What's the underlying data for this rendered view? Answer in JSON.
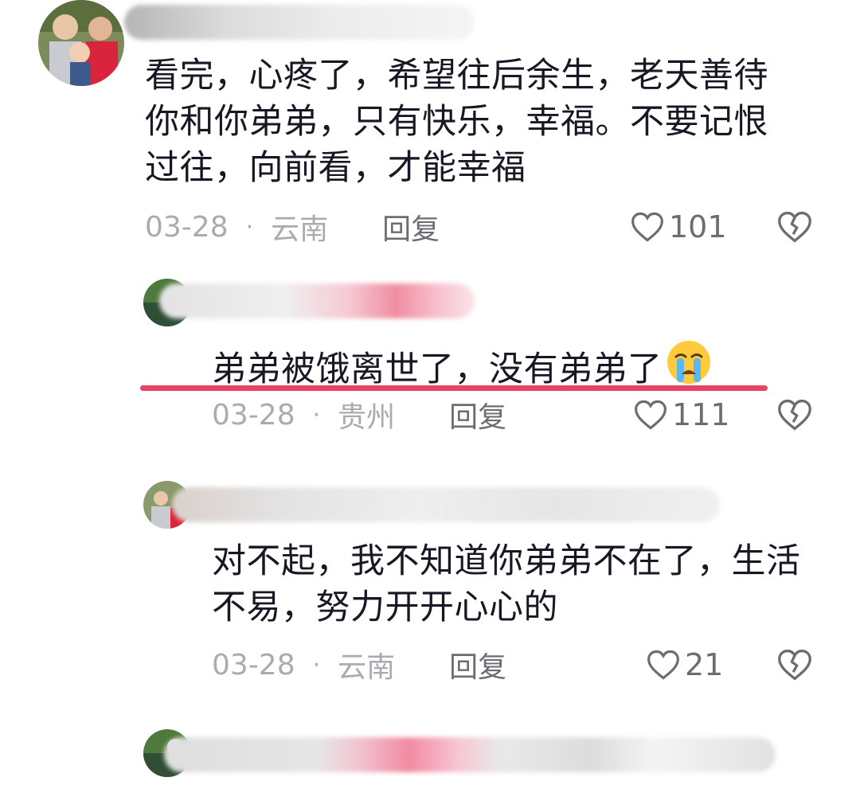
{
  "comments": [
    {
      "text_lines": [
        "看完，心疼了，希望往后余生，老天善待",
        "你和你弟弟，只有快乐，幸福。不要记恨",
        "过往，向前看，才能幸福"
      ],
      "date": "03-28",
      "separator": "·",
      "location": "云南",
      "reply_label": "回复",
      "likes": "101"
    },
    {
      "text": "弟弟被饿离世了，没有弟弟了",
      "emoji": "loudly-crying-face",
      "date": "03-28",
      "separator": "·",
      "location": "贵州",
      "reply_label": "回复",
      "likes": "111",
      "highlight_color": "#e54563"
    },
    {
      "text_lines": [
        "对不起，我不知道你弟弟不在了，生活",
        "不易，努力开开心心的"
      ],
      "date": "03-28",
      "separator": "·",
      "location": "云南",
      "reply_label": "回复",
      "likes": "21"
    }
  ],
  "icons": {
    "like": "heart-outline-icon",
    "dislike": "broken-heart-icon"
  },
  "colors": {
    "text": "#161823",
    "meta": "#a9abb0",
    "action": "#6b6d73",
    "accent_pink": "#f48aa0"
  }
}
